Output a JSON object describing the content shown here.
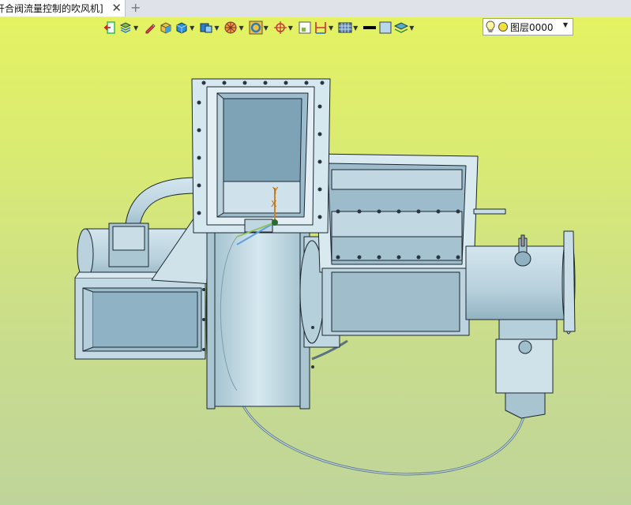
{
  "tab": {
    "title": "开合阀流量控制的吹风机]",
    "close": "✕",
    "add": "+"
  },
  "toolbar": {
    "buttons": [
      {
        "icon": "exit-icon",
        "dropdown": false
      },
      {
        "icon": "layers-stack-icon",
        "dropdown": true
      },
      {
        "icon": "pen-icon",
        "dropdown": false
      },
      {
        "icon": "box-shaded-icon",
        "dropdown": false
      },
      {
        "icon": "box-blue-icon",
        "dropdown": true
      },
      {
        "icon": "view-cube-icon",
        "dropdown": true
      },
      {
        "icon": "render-wheel-icon",
        "dropdown": true
      },
      {
        "icon": "ring-icon",
        "dropdown": true
      },
      {
        "icon": "target-icon",
        "dropdown": true
      },
      {
        "icon": "frame-icon",
        "dropdown": false
      },
      {
        "icon": "dimension-icon",
        "dropdown": true
      },
      {
        "icon": "grid-icon",
        "dropdown": true
      },
      {
        "icon": "line-weight-icon",
        "dropdown": false
      },
      {
        "icon": "color-swatch-icon",
        "dropdown": false
      },
      {
        "icon": "layers-icon",
        "dropdown": true
      }
    ],
    "layer": {
      "label": "图层0000"
    }
  },
  "colors": {
    "background_top": "#e4f262",
    "background_bottom": "#bfd49a",
    "model_fill": "#b9d2de",
    "model_edge": "#1c2630"
  },
  "axis_labels": {
    "y": "Y",
    "x": "X"
  }
}
